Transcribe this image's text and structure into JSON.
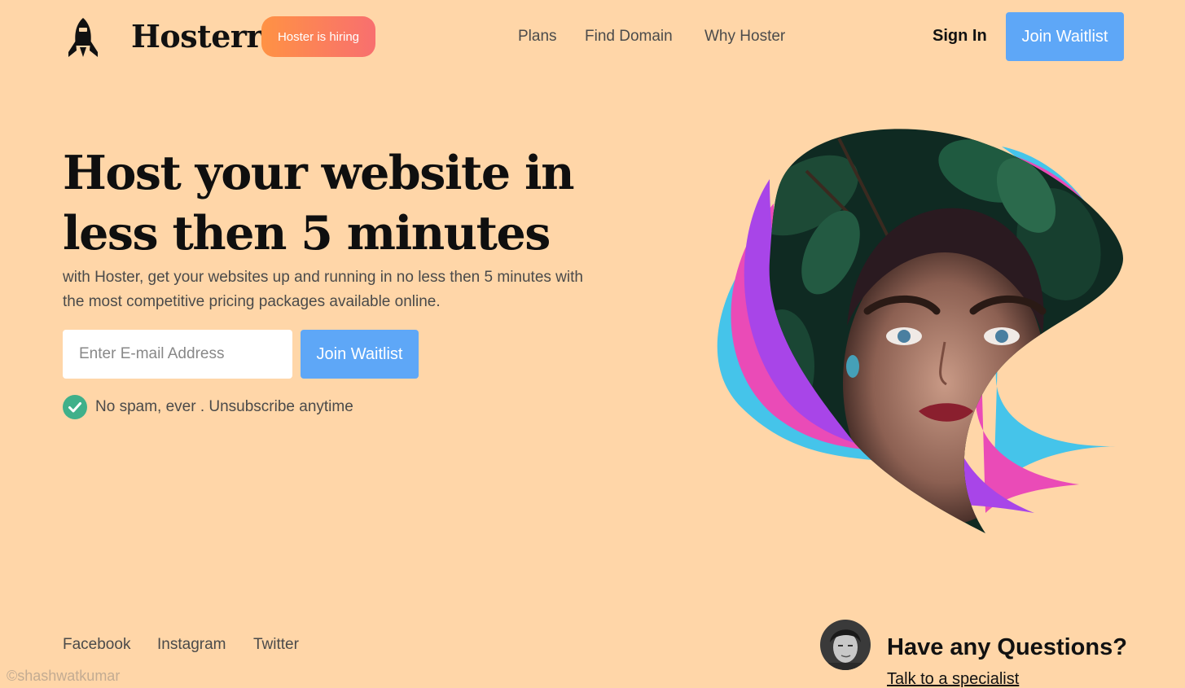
{
  "header": {
    "brand": "Hosterr",
    "hiring_badge": "Hoster is hiring",
    "nav": [
      "Plans",
      "Find Domain",
      "Why Hoster"
    ],
    "sign_in": "Sign In",
    "join_waitlist": "Join Waitlist"
  },
  "hero": {
    "title": "Host your website in less then 5 minutes",
    "subtitle": "with Hoster, get your websites up and running in no less then 5 minutes with the most competitive pricing packages available online.",
    "email_placeholder": "Enter E-mail Address",
    "join_waitlist": "Join Waitlist",
    "note": "No spam, ever . Unsubscribe anytime"
  },
  "footer": {
    "social": [
      "Facebook",
      "Instagram",
      "Twitter"
    ],
    "watermark": "©shashwatkumar",
    "question_title": "Have any Questions?",
    "question_link": "Talk to a specialist"
  },
  "colors": {
    "background": "#ffd6a8",
    "accent_blue": "#5ea7f7",
    "badge_gradient_start": "#ff9244",
    "badge_gradient_end": "#f86f6f",
    "check_green": "#3fb08a",
    "ribbon_cyan": "#45c4ea",
    "ribbon_pink": "#ea4bb7",
    "ribbon_purple": "#a845e8"
  },
  "icons": {
    "logo": "rocket-icon",
    "check": "check-circle-icon",
    "avatar": "person-avatar"
  }
}
